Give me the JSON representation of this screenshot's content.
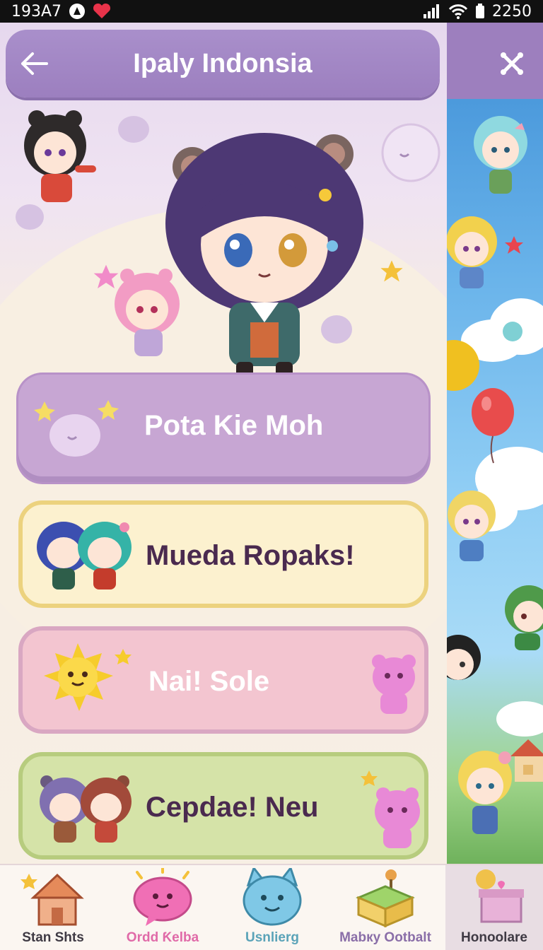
{
  "status_bar": {
    "time": "193A7",
    "battery": "2250",
    "icons": [
      "app-logo-icon",
      "heart-icon",
      "signal-icon",
      "wifi-icon",
      "battery-icon"
    ]
  },
  "header": {
    "title": "Ipaly Indonsia",
    "back_icon": "arrow-left-icon",
    "close_icon": "close-icon"
  },
  "menu": [
    {
      "label": "Pota Kie Moh",
      "color": "#c7a6d3"
    },
    {
      "label": "Mueda Ropaks!",
      "color": "#fcf1cf"
    },
    {
      "label": "Nai! Sole",
      "color": "#f3c5d0"
    },
    {
      "label": "Cepdae! Neu",
      "color": "#d5e3a8"
    }
  ],
  "bottom_nav": [
    {
      "label": "Stan Shts",
      "icon": "house-icon",
      "color": "#3f3a44"
    },
    {
      "label": "Ordd Ƙelba",
      "icon": "chat-bubble-icon",
      "color": "#e06aa8"
    },
    {
      "label": "Usnlierg",
      "icon": "cat-face-icon",
      "color": "#5aa3b8"
    },
    {
      "label": "Mabку Ootbalt",
      "icon": "garden-box-icon",
      "color": "#8a6ea8"
    },
    {
      "label": "Honoolare",
      "icon": "gift-box-icon",
      "color": "#3f3a44"
    }
  ]
}
